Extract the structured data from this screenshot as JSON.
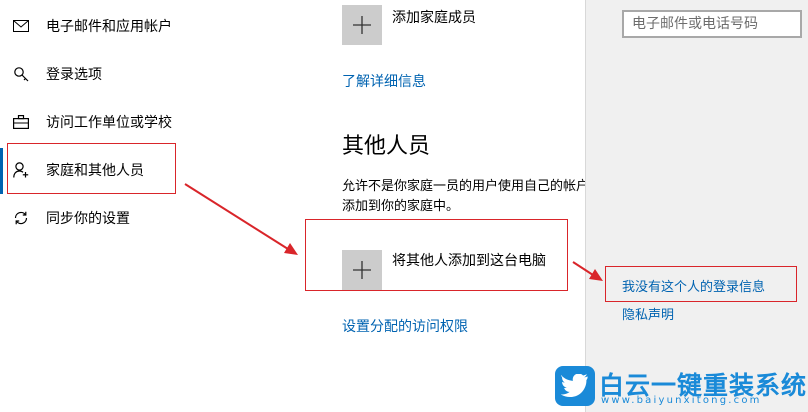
{
  "sidebar": {
    "items": [
      {
        "label": "电子邮件和应用帐户",
        "icon": "mail-icon"
      },
      {
        "label": "登录选项",
        "icon": "key-icon"
      },
      {
        "label": "访问工作单位或学校",
        "icon": "briefcase-icon"
      },
      {
        "label": "家庭和其他人员",
        "icon": "person-add-icon",
        "active": true
      },
      {
        "label": "同步你的设置",
        "icon": "sync-icon"
      }
    ]
  },
  "main": {
    "add_family_label": "添加家庭成员",
    "learn_more_link": "了解详细信息",
    "other_people_heading": "其他人员",
    "description_line1": "允许不是你家庭一员的用户使用自己的帐户登录。这样不会将其",
    "description_line2": "添加到你的家庭中。",
    "add_other_label": "将其他人添加到这台电脑",
    "set_access_link": "设置分配的访问权限"
  },
  "panel": {
    "email_placeholder": "电子邮件或电话号码",
    "no_signin_info_link": "我没有这个人的登录信息",
    "privacy_link": "隐私声明"
  },
  "watermark": {
    "title": "白云一键重装系统",
    "url": "www.baiyunxitong.com"
  },
  "colors": {
    "accent": "#0063b1",
    "annotation_red": "#d9252a",
    "tile_gray": "#cccccc",
    "panel_bg": "#f0f0f0",
    "watermark_blue": "#1a8ad8"
  }
}
